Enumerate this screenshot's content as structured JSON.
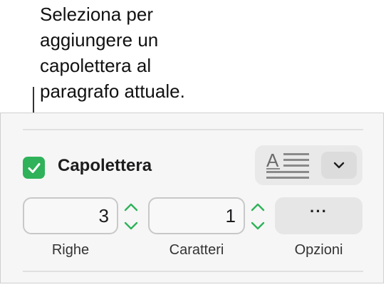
{
  "callout": {
    "text": "Seleziona per\naggiungere un\ncapolettera al\nparagrafo attuale."
  },
  "drop_cap": {
    "label": "Capolettera",
    "checked": true,
    "checkbox_color": "#2fb25a",
    "style_preview_icon": "drop-cap-style-icon",
    "dropdown_icon": "chevron-down-icon"
  },
  "fields": {
    "rows": {
      "value": "3",
      "label": "Righe"
    },
    "characters": {
      "value": "1",
      "label": "Caratteri"
    },
    "options": {
      "button_text": "···",
      "label": "Opzioni"
    }
  },
  "colors": {
    "accent_green": "#2fb25a",
    "panel_background": "#f6f6f6"
  }
}
